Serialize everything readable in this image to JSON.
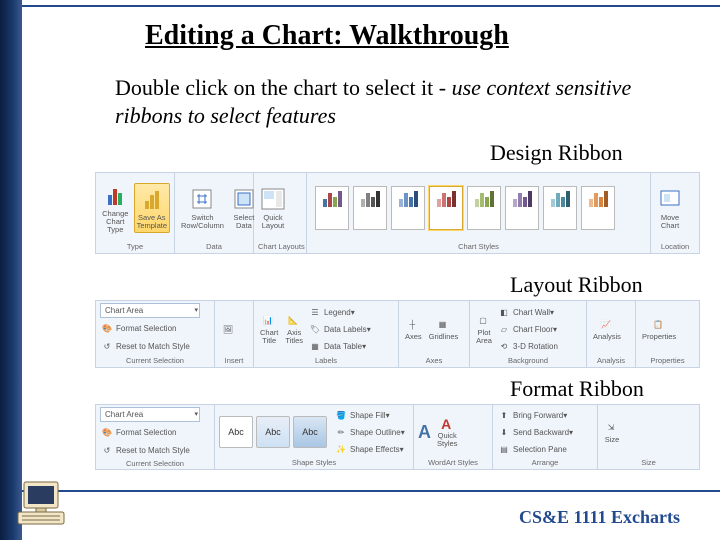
{
  "title": "Editing a Chart: Walkthrough",
  "subtitle_lead": "Double click on the chart to select it",
  "subtitle_italic": "- use context sensitive ribbons to select features",
  "labels": {
    "design": "Design Ribbon",
    "layout": "Layout Ribbon",
    "format": "Format Ribbon"
  },
  "footer": "CS&E 1111  Excharts",
  "design": {
    "type": {
      "group": "Type",
      "change": "Change\nChart Type",
      "save": "Save As\nTemplate"
    },
    "data": {
      "group": "Data",
      "switch": "Switch\nRow/Column",
      "select": "Select\nData"
    },
    "layouts": {
      "group": "Chart Layouts",
      "quick": "Quick\nLayout"
    },
    "styles": {
      "group": "Chart Styles"
    },
    "location": {
      "group": "Location",
      "move": "Move\nChart"
    }
  },
  "layout": {
    "sel": {
      "group": "Current Selection",
      "area": "Chart Area",
      "fmt": "Format Selection",
      "reset": "Reset to Match Style"
    },
    "insert": {
      "group": "Insert"
    },
    "labels_g": {
      "group": "Labels",
      "title": "Chart\nTitle",
      "axis": "Axis\nTitles",
      "legend": "Legend",
      "dlabels": "Data Labels",
      "dtable": "Data Table"
    },
    "axes": {
      "group": "Axes",
      "axes": "Axes",
      "grid": "Gridlines"
    },
    "bg": {
      "group": "Background",
      "plot": "Plot\nArea",
      "wall": "Chart Wall",
      "floor": "Chart Floor",
      "rot": "3-D Rotation"
    },
    "analysis": {
      "group": "Analysis",
      "an": "Analysis"
    },
    "prop": {
      "group": "Properties",
      "p": "Properties"
    }
  },
  "format": {
    "sel": {
      "group": "Current Selection",
      "area": "Chart Area",
      "fmt": "Format Selection",
      "reset": "Reset to Match Style"
    },
    "shapes": {
      "group": "Shape Styles",
      "abc": "Abc",
      "fill": "Shape Fill",
      "outline": "Shape Outline",
      "effects": "Shape Effects"
    },
    "wa": {
      "group": "WordArt Styles",
      "quick": "Quick\nStyles"
    },
    "arrange": {
      "group": "Arrange",
      "bf": "Bring Forward",
      "sb": "Send Backward",
      "sp": "Selection Pane"
    },
    "size": {
      "group": "Size",
      "s": "Size"
    }
  }
}
